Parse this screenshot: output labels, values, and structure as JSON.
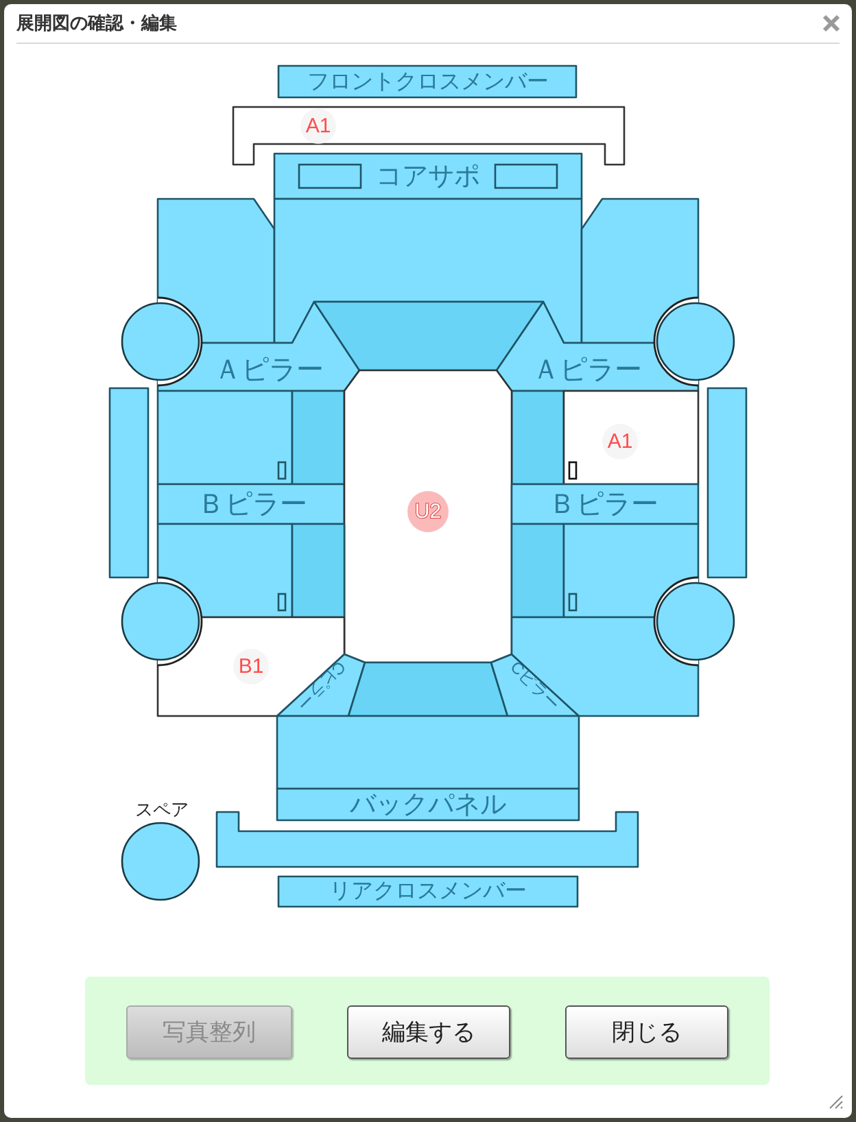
{
  "window": {
    "title": "展開図の確認・編集"
  },
  "diagram": {
    "parts": [
      {
        "kind": "panel",
        "label": "フロントクロスメンバー"
      },
      {
        "kind": "panel",
        "damage": {
          "code": "A1",
          "kind": "plain"
        }
      },
      {
        "kind": "panel",
        "label": "コアサポ"
      },
      {
        "kind": "panel"
      },
      {
        "kind": "panel"
      },
      {
        "kind": "panel"
      },
      {
        "kind": "panel",
        "label": "Ａピラー"
      },
      {
        "kind": "glass"
      },
      {
        "kind": "panel",
        "label": "Ａピラー"
      },
      {
        "kind": "wheel"
      },
      {
        "kind": "wheel"
      },
      {
        "kind": "panel"
      },
      {
        "kind": "panel"
      },
      {
        "kind": "glass"
      },
      {
        "kind": "glass"
      },
      {
        "kind": "panel",
        "damage": {
          "code": "A1",
          "kind": "plain"
        }
      },
      {
        "kind": "panel"
      },
      {
        "kind": "panel",
        "label": "Ｂピラー"
      },
      {
        "kind": "panel",
        "damage": {
          "code": "U2",
          "kind": "badge"
        }
      },
      {
        "kind": "panel",
        "label": "Ｂピラー"
      },
      {
        "kind": "panel"
      },
      {
        "kind": "glass"
      },
      {
        "kind": "glass"
      },
      {
        "kind": "panel"
      },
      {
        "kind": "wheel"
      },
      {
        "kind": "wheel"
      },
      {
        "kind": "panel",
        "damage": {
          "code": "B1",
          "kind": "plain"
        }
      },
      {
        "kind": "panel",
        "label": "Cピラー"
      },
      {
        "kind": "glass"
      },
      {
        "kind": "panel",
        "label": "Cピラー"
      },
      {
        "kind": "panel"
      },
      {
        "kind": "panel"
      },
      {
        "kind": "spare",
        "label": "スペア"
      },
      {
        "kind": "panel",
        "label": "バックパネル"
      },
      {
        "kind": "panel"
      },
      {
        "kind": "panel",
        "label": "リアクロスメンバー"
      }
    ]
  },
  "buttons": [
    {
      "label": "写真整列",
      "disabled": true
    },
    {
      "label": "編集する",
      "disabled": false
    },
    {
      "label": "閉じる",
      "disabled": false
    }
  ]
}
